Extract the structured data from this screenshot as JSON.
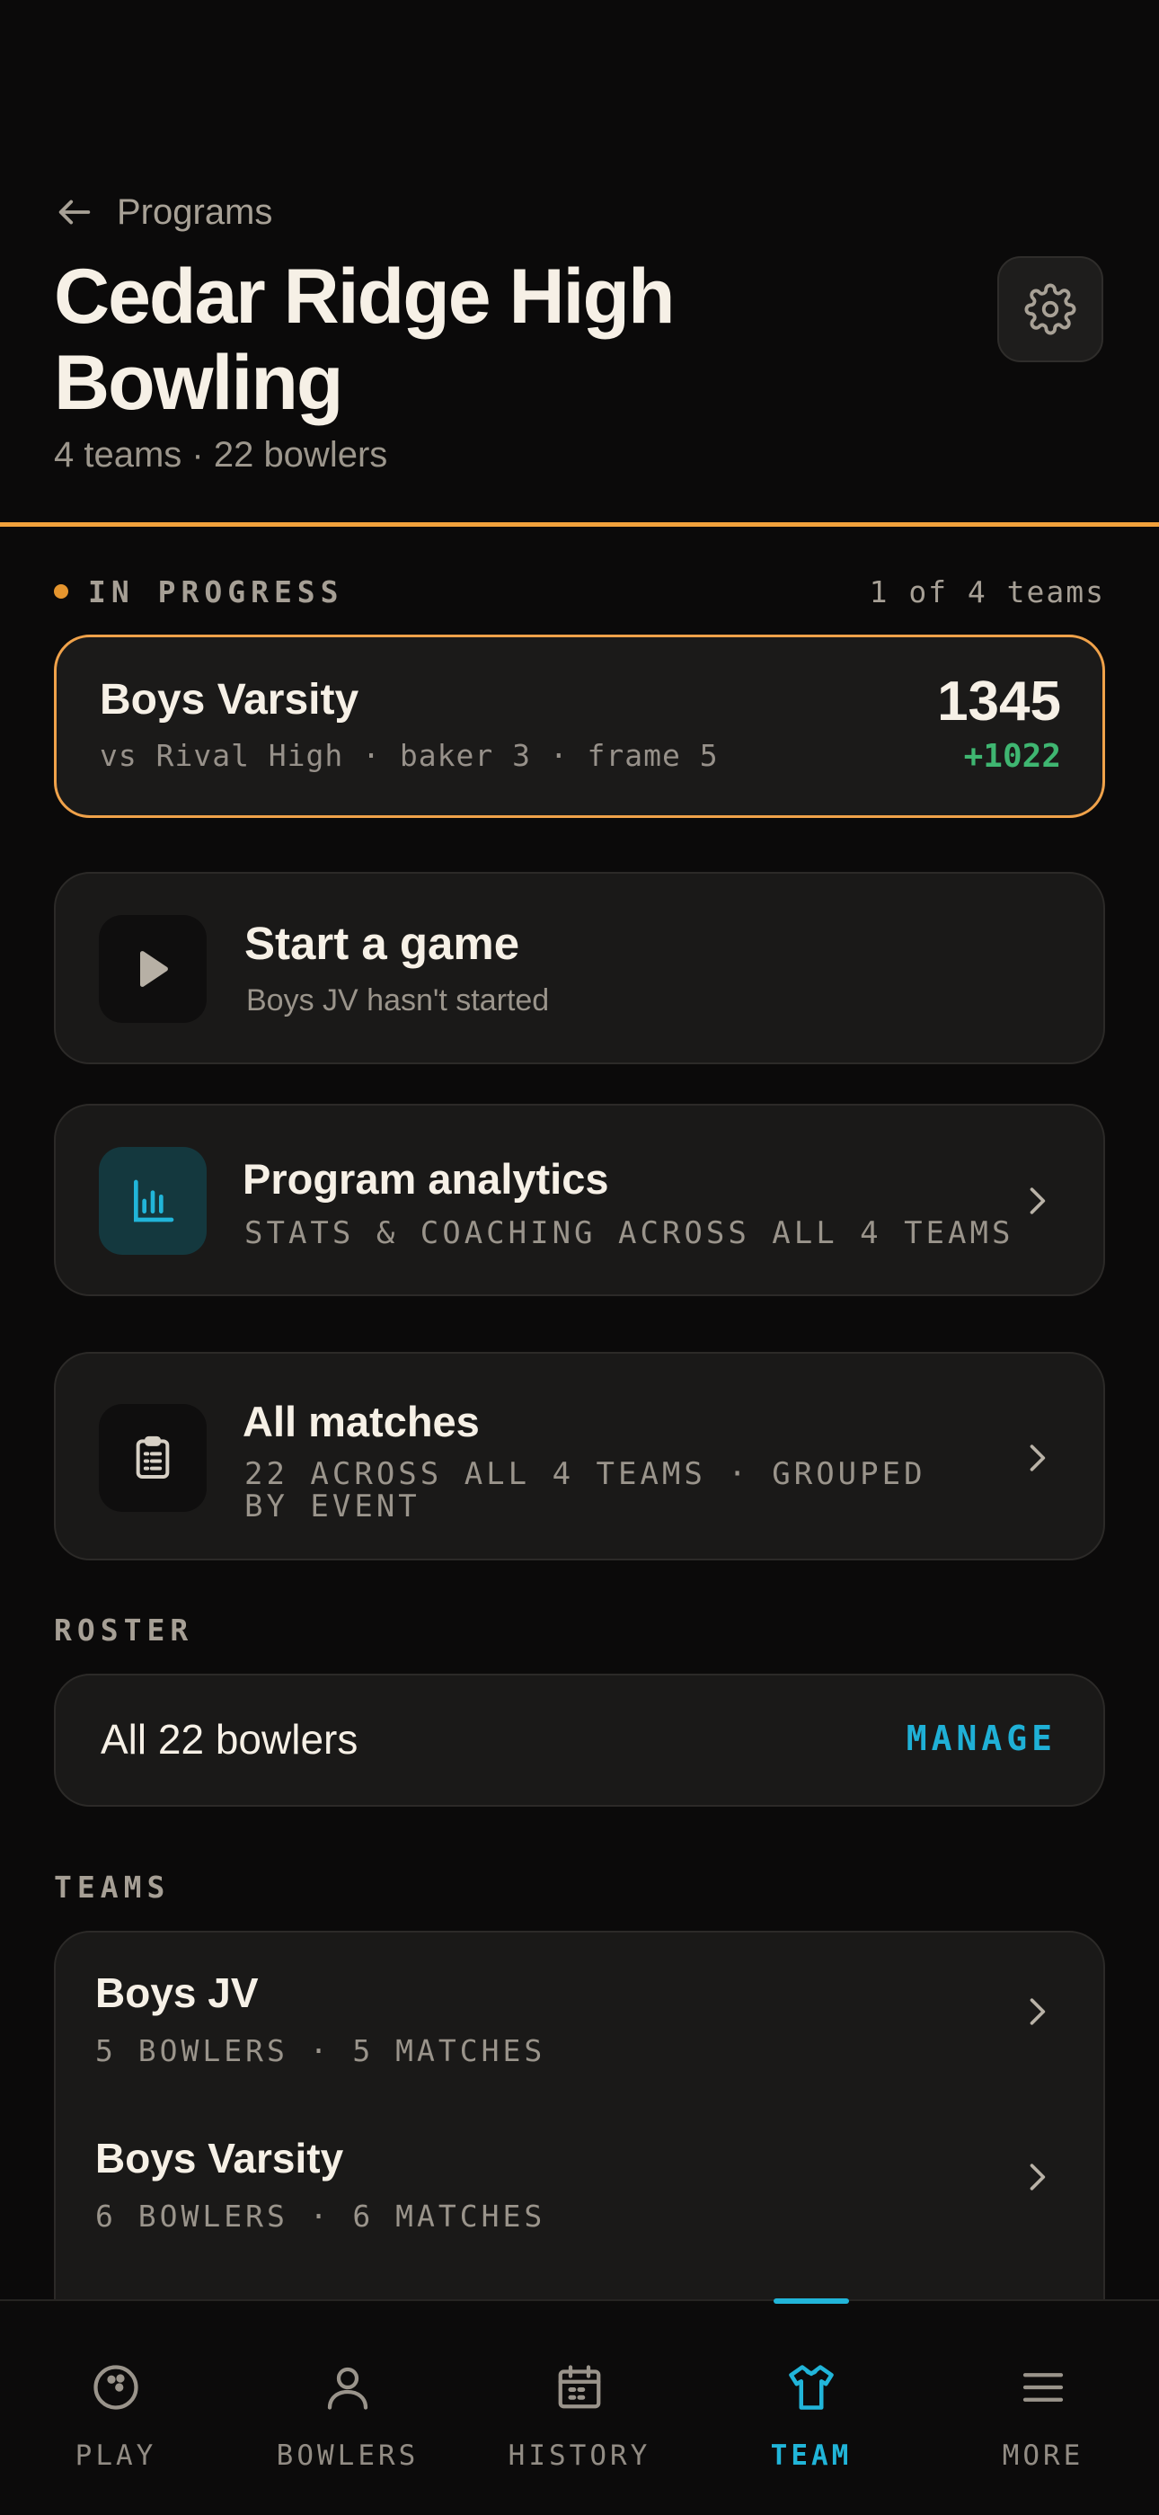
{
  "header": {
    "back_label": "Programs",
    "title": "Cedar Ridge High Bowling",
    "subtitle": "4 teams · 22 bowlers"
  },
  "in_progress": {
    "label": "IN PROGRESS",
    "count": "1 of 4 teams",
    "card": {
      "team": "Boys Varsity",
      "detail": "vs Rival High · baker 3 · frame 5",
      "score": "1345",
      "delta": "+1022"
    }
  },
  "actions": {
    "start": {
      "title": "Start a game",
      "subtitle": "Boys JV hasn't started"
    },
    "analytics": {
      "title": "Program analytics",
      "subtitle": "STATS & COACHING ACROSS ALL 4 TEAMS"
    },
    "matches": {
      "title": "All matches",
      "subtitle": "22 ACROSS ALL 4 TEAMS · GROUPED BY EVENT"
    }
  },
  "roster": {
    "label": "ROSTER",
    "summary": "All 22 bowlers",
    "manage": "MANAGE"
  },
  "teams": {
    "label": "TEAMS",
    "items": [
      {
        "name": "Boys JV",
        "meta": "5 BOWLERS · 5 MATCHES"
      },
      {
        "name": "Boys Varsity",
        "meta": "6 BOWLERS · 6 MATCHES"
      }
    ]
  },
  "nav": {
    "items": [
      {
        "label": "PLAY",
        "icon": "bowling-ball-icon"
      },
      {
        "label": "BOWLERS",
        "icon": "person-icon"
      },
      {
        "label": "HISTORY",
        "icon": "calendar-icon"
      },
      {
        "label": "TEAM",
        "icon": "shirt-icon",
        "active": true
      },
      {
        "label": "MORE",
        "icon": "menu-icon"
      }
    ]
  },
  "colors": {
    "accent_orange": "#f2a13c",
    "accent_teal": "#21b5d9",
    "positive_green": "#3fb671",
    "background": "#0b0a0a",
    "card": "#1a1918"
  }
}
